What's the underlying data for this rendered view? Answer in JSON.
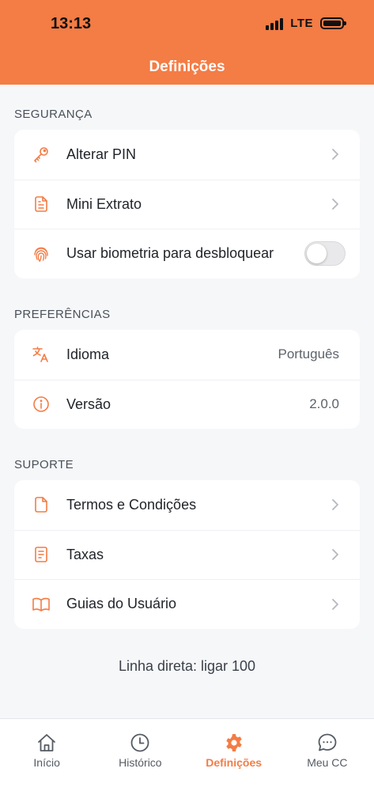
{
  "status_bar": {
    "time": "13:13",
    "network": "LTE"
  },
  "header": {
    "title": "Definições"
  },
  "sections": {
    "security": {
      "label": "SEGURANÇA",
      "items": [
        {
          "label": "Alterar PIN",
          "icon": "key-icon"
        },
        {
          "label": "Mini Extrato",
          "icon": "document-icon"
        },
        {
          "label": "Usar biometria para desbloquear",
          "icon": "fingerprint-icon",
          "toggle": false
        }
      ]
    },
    "preferences": {
      "label": "PREFERÊNCIAS",
      "items": [
        {
          "label": "Idioma",
          "value": "Português",
          "icon": "translate-icon"
        },
        {
          "label": "Versão",
          "value": "2.0.0",
          "icon": "info-icon"
        }
      ]
    },
    "support": {
      "label": "SUPORTE",
      "items": [
        {
          "label": "Termos e Condições",
          "icon": "file-icon"
        },
        {
          "label": "Taxas",
          "icon": "receipt-icon"
        },
        {
          "label": "Guias do Usuário",
          "icon": "book-icon"
        }
      ]
    }
  },
  "hotline": "Linha direta: ligar 100",
  "tabbar": {
    "items": [
      {
        "label": "Início",
        "icon": "home-icon"
      },
      {
        "label": "Histórico",
        "icon": "clock-icon"
      },
      {
        "label": "Definições",
        "icon": "gear-icon",
        "active": true
      },
      {
        "label": "Meu CC",
        "icon": "chat-icon"
      }
    ]
  },
  "colors": {
    "accent": "#f47c45",
    "background": "#f6f7f9",
    "card": "#ffffff"
  }
}
